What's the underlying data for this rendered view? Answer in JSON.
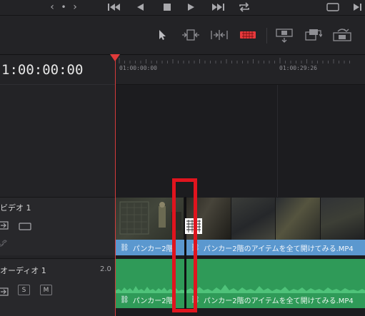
{
  "transport": {
    "icons": [
      "chevron-left-icon",
      "dot-icon",
      "chevron-right-icon",
      "skip-to-start-icon",
      "play-reverse-icon",
      "stop-icon",
      "play-icon",
      "skip-to-end-icon",
      "loop-icon",
      "fullscreen-icon",
      "next-frame-icon"
    ],
    "chevron_left": "‹",
    "dot": "•",
    "chevron_right": "›"
  },
  "toolbar": {
    "icons": [
      "selection-tool-icon",
      "trim-edit-icon",
      "dynamic-trim-icon",
      "blade-edit-icon",
      "insert-clip-icon",
      "overwrite-clip-icon",
      "replace-clip-icon"
    ]
  },
  "header": {
    "timecode": "1:00:00:00"
  },
  "ruler": {
    "labels": [
      "01:00:00:00",
      "01:00:29:26"
    ]
  },
  "tracks": {
    "video": {
      "name": "ビデオ 1",
      "icons": [
        "auto-select-icon",
        "toggle-track-icon",
        "link-icon"
      ]
    },
    "audio": {
      "name": "オーディオ 1",
      "level": "2.0",
      "solo_label": "S",
      "mute_label": "M",
      "icons": [
        "auto-select-icon"
      ]
    }
  },
  "clips": {
    "video_left_label": "パンカー2階",
    "video_right_label": "パンカー2階のアイテムを全て開けてみる.MP4",
    "audio_left_label": "パンカー2階",
    "audio_right_label": "パンカー2階のアイテムを全て開けてみる.MP4"
  },
  "colors": {
    "accent_red": "#e0141e",
    "video_clip_label": "#5b98cf",
    "audio_clip": "#2f9a58",
    "playhead": "#e03a3a"
  }
}
